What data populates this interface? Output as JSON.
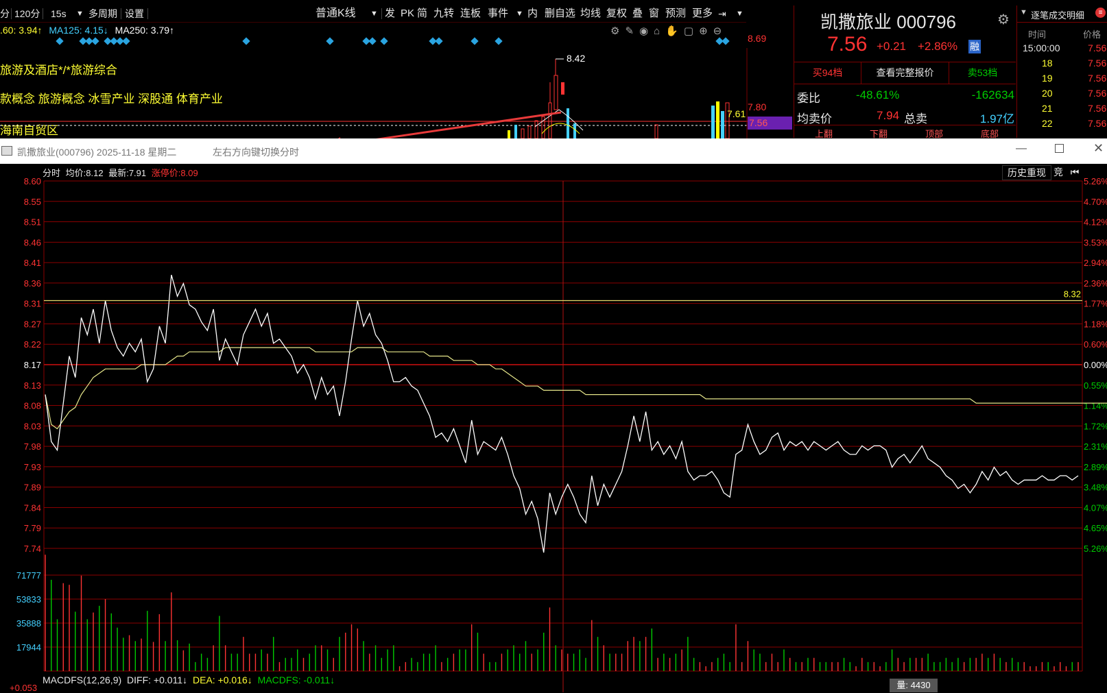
{
  "toolbar": {
    "items": [
      "分",
      "120分",
      "15s",
      "多周期",
      "设置",
      "普通K线",
      "发",
      "PK",
      "简",
      "九转",
      "连板",
      "事件",
      "内",
      "删自选",
      "均线",
      "复权",
      "叠",
      "窗",
      "预测",
      "更多"
    ]
  },
  "kline": {
    "ma_text": [
      ".60: 3.94↑",
      "MA125: 4.15↓",
      "MA250: 3.79↑"
    ],
    "indicators": [
      "旅游及酒店*/*旅游综合",
      "款概念 旅游概念 冰雪产业 深股通 体育产业",
      "海南自贸区"
    ],
    "price_labels": {
      "high": "8.42",
      "scale_top": "8.69",
      "scale_mid": "7.80",
      "last_bar": "7.61",
      "current": "7.56"
    }
  },
  "quote": {
    "name": "凯撒旅业",
    "code": "000796",
    "price": "7.56",
    "change": "+0.21",
    "change_pct": "+2.86%",
    "badge": "融",
    "tabs": [
      "买94档",
      "查看完整报价",
      "卖53档"
    ],
    "weibi_label": "委比",
    "weibi_pct": "-48.61%",
    "weibi_val": "-162634",
    "avg_label": "均卖价",
    "avg_price": "7.94",
    "total_label": "总卖",
    "total_val": "1.97亿",
    "nav": [
      "上翻",
      "下翻",
      "顶部",
      "底部"
    ]
  },
  "ticks": {
    "title": "逐笔成交明细",
    "headers": [
      "时间",
      "价格"
    ],
    "rows": [
      {
        "time": "15:00:00",
        "price": "7.56"
      },
      {
        "time": "18",
        "price": "7.56"
      },
      {
        "time": "19",
        "price": "7.56"
      },
      {
        "time": "20",
        "price": "7.56"
      },
      {
        "time": "21",
        "price": "7.56"
      },
      {
        "time": "22",
        "price": "7.56"
      }
    ]
  },
  "window": {
    "title": "凯撒旅业(000796) 2025-11-18 星期二",
    "hint": "左右方向键切换分时"
  },
  "intraday": {
    "header": {
      "label": "分时",
      "avg_label": "均价:",
      "avg": "8.12",
      "last_label": "最新:",
      "last": "7.91",
      "limit_label": "涨停价:",
      "limit": "8.09"
    },
    "buttons": {
      "replay": "历史重现",
      "auction": "竞"
    },
    "ref_label": "8.32",
    "volume_tooltip": "量: 4430",
    "macd": {
      "name": "MACDFS(12,26,9)",
      "diff": "DIFF: +0.011↓",
      "dea": "DEA: +0.016↓",
      "macdfs": "MACDFS: -0.011↓",
      "axis": "+0.053"
    }
  },
  "colors": {
    "up": "#ff3333",
    "down": "#00cc00",
    "price_line": "#ffffff",
    "avg_line": "#e6e68a",
    "grid": "#8b0000",
    "accent_blue": "#2aa4e0"
  },
  "chart_data": {
    "type": "line",
    "y_ticks": [
      "8.60",
      "8.55",
      "8.51",
      "8.46",
      "8.41",
      "8.36",
      "8.31",
      "8.27",
      "8.22",
      "8.17",
      "8.13",
      "8.08",
      "8.03",
      "7.98",
      "7.93",
      "7.89",
      "7.84",
      "7.79",
      "7.74"
    ],
    "y_pct_ticks": [
      "5.26%",
      "4.70%",
      "4.12%",
      "3.53%",
      "2.94%",
      "2.36%",
      "1.77%",
      "1.18%",
      "0.60%",
      "0.00%",
      "0.55%",
      "1.14%",
      "1.72%",
      "2.31%",
      "2.89%",
      "3.48%",
      "4.07%",
      "4.65%",
      "5.26%"
    ],
    "ylim": [
      7.74,
      8.6
    ],
    "prev_close": 8.17,
    "ref_line": 8.32,
    "price": [
      8.1,
      7.99,
      7.97,
      8.08,
      8.19,
      8.14,
      8.28,
      8.24,
      8.3,
      8.22,
      8.32,
      8.25,
      8.21,
      8.19,
      8.22,
      8.2,
      8.23,
      8.13,
      8.16,
      8.26,
      8.22,
      8.38,
      8.33,
      8.36,
      8.31,
      8.3,
      8.27,
      8.25,
      8.3,
      8.18,
      8.23,
      8.2,
      8.17,
      8.24,
      8.27,
      8.3,
      8.26,
      8.29,
      8.22,
      8.23,
      8.21,
      8.19,
      8.15,
      8.17,
      8.14,
      8.09,
      8.14,
      8.1,
      8.12,
      8.05,
      8.13,
      8.23,
      8.32,
      8.26,
      8.29,
      8.24,
      8.22,
      8.18,
      8.13,
      8.13,
      8.14,
      8.12,
      8.11,
      8.08,
      8.05,
      8.0,
      8.01,
      7.99,
      8.02,
      7.98,
      7.94,
      8.04,
      7.96,
      7.99,
      7.98,
      7.97,
      8.0,
      7.96,
      7.91,
      7.88,
      7.82,
      7.85,
      7.81,
      7.73,
      7.87,
      7.82,
      7.86,
      7.89,
      7.86,
      7.82,
      7.8,
      7.91,
      7.84,
      7.89,
      7.86,
      7.89,
      7.92,
      7.98,
      8.05,
      7.99,
      8.06,
      7.97,
      7.99,
      7.96,
      7.98,
      7.95,
      7.99,
      7.92,
      7.9,
      7.91,
      7.91,
      7.92,
      7.9,
      7.87,
      7.86,
      7.96,
      7.97,
      8.03,
      7.99,
      7.96,
      7.97,
      8.0,
      8.01,
      7.97,
      7.99,
      7.98,
      7.99,
      7.97,
      7.99,
      7.98,
      7.97,
      7.98,
      7.99,
      7.97,
      7.96,
      7.96,
      7.98,
      7.97,
      7.98,
      7.98,
      7.97,
      7.93,
      7.95,
      7.96,
      7.94,
      7.96,
      7.98,
      7.95,
      7.94,
      7.93,
      7.91,
      7.9,
      7.88,
      7.89,
      7.87,
      7.89,
      7.92,
      7.9,
      7.93,
      7.91,
      7.92,
      7.9,
      7.89,
      7.9,
      7.9,
      7.9,
      7.91,
      7.9,
      7.9,
      7.91,
      7.91,
      7.9,
      7.91
    ],
    "avg": [
      8.1,
      8.03,
      8.02,
      8.04,
      8.06,
      8.07,
      8.1,
      8.12,
      8.14,
      8.15,
      8.16,
      8.16,
      8.16,
      8.16,
      8.16,
      8.16,
      8.17,
      8.17,
      8.17,
      8.17,
      8.17,
      8.18,
      8.19,
      8.19,
      8.2,
      8.2,
      8.2,
      8.2,
      8.2,
      8.2,
      8.21,
      8.21,
      8.21,
      8.21,
      8.21,
      8.21,
      8.21,
      8.21,
      8.21,
      8.21,
      8.21,
      8.21,
      8.21,
      8.21,
      8.21,
      8.2,
      8.2,
      8.2,
      8.2,
      8.2,
      8.2,
      8.2,
      8.21,
      8.21,
      8.21,
      8.21,
      8.21,
      8.2,
      8.2,
      8.2,
      8.2,
      8.2,
      8.2,
      8.2,
      8.19,
      8.19,
      8.19,
      8.19,
      8.18,
      8.18,
      8.18,
      8.18,
      8.17,
      8.17,
      8.17,
      8.16,
      8.16,
      8.15,
      8.14,
      8.13,
      8.12,
      8.12,
      8.12,
      8.11,
      8.11,
      8.11,
      8.11,
      8.11,
      8.11,
      8.11,
      8.1,
      8.1,
      8.1,
      8.1,
      8.1,
      8.1,
      8.1,
      8.1,
      8.1,
      8.1,
      8.1,
      8.1,
      8.1,
      8.1,
      8.1,
      8.1,
      8.1,
      8.1,
      8.1,
      8.1,
      8.09,
      8.09,
      8.09,
      8.09,
      8.09,
      8.09,
      8.09,
      8.09,
      8.09,
      8.09,
      8.09,
      8.09,
      8.09,
      8.09,
      8.09,
      8.09,
      8.09,
      8.09,
      8.09,
      8.09,
      8.09,
      8.09,
      8.09,
      8.09,
      8.09,
      8.09,
      8.09,
      8.09,
      8.09,
      8.09,
      8.09,
      8.09,
      8.09,
      8.09,
      8.09,
      8.09,
      8.09,
      8.09,
      8.09,
      8.09,
      8.09,
      8.09,
      8.09,
      8.09,
      8.09,
      8.08,
      8.08,
      8.08,
      8.08,
      8.08,
      8.08,
      8.08,
      8.08,
      8.08,
      8.08,
      8.08,
      8.08,
      8.08,
      8.08,
      8.08,
      8.08,
      8.08,
      8.08,
      8.08,
      8.08,
      8.08,
      8.08,
      8.08
    ],
    "volume_ticks": [
      "71777",
      "53833",
      "35888",
      "17944"
    ],
    "volume_max": 89721
  }
}
